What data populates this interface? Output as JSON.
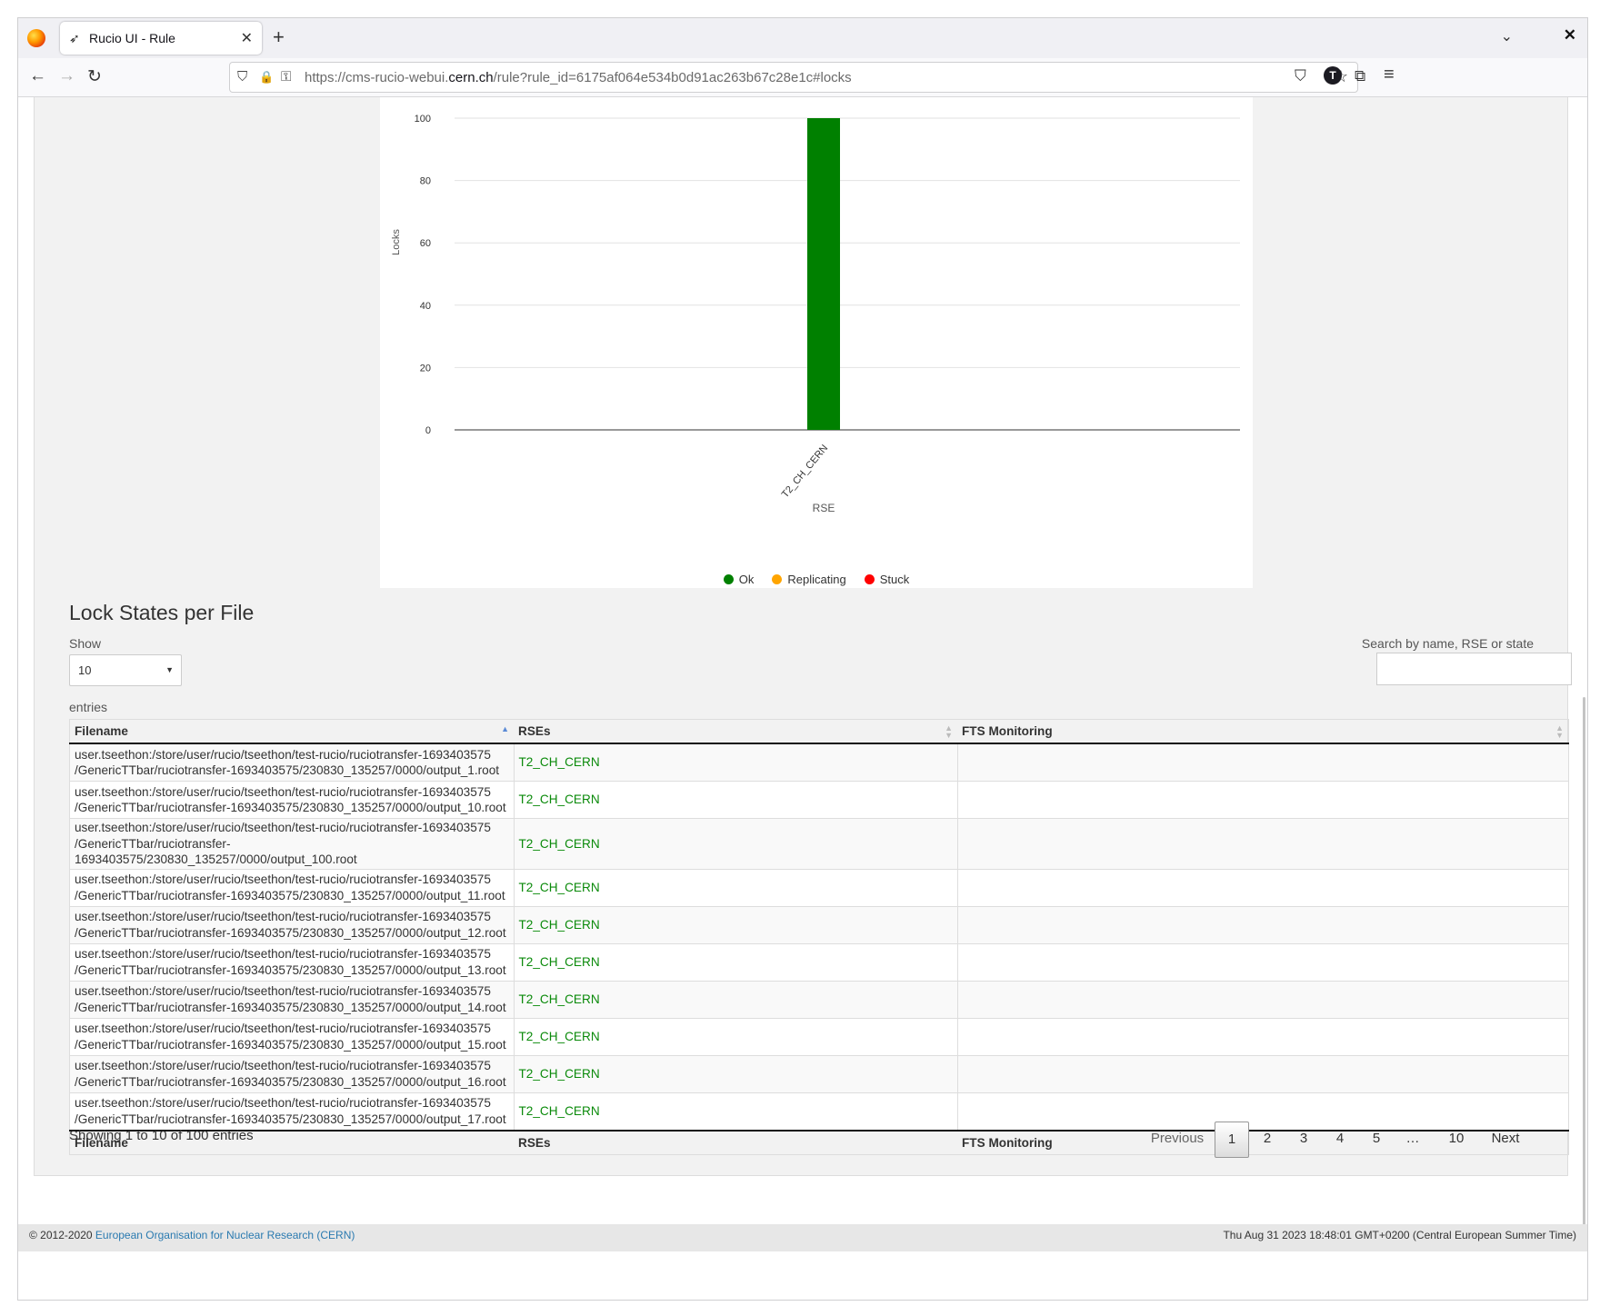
{
  "browser": {
    "tab_title": "Rucio UI - Rule",
    "tab_icon": "rucio-favicon",
    "url_prefix": "https://cms-rucio-webui.",
    "url_host": "cern.ch",
    "url_suffix": "/rule?rule_id=6175af064e534b0d91ac263b67c28e1c#locks",
    "account_initial": "T",
    "icons": {
      "close": "✕",
      "newtab": "+",
      "tab_list": "⌄",
      "window_close": "✕",
      "back": "←",
      "forward": "→",
      "reload": "↻",
      "shield": "⛉",
      "lock": "🔒",
      "permissions": "⚿",
      "star": "☆",
      "pocket": "⛉",
      "extensions": "⧉",
      "menu": "≡"
    }
  },
  "chart_data": {
    "type": "bar",
    "categories": [
      "T2_CH_CERN"
    ],
    "series": [
      {
        "name": "Ok",
        "color": "#008000",
        "values": [
          100
        ]
      },
      {
        "name": "Replicating",
        "color": "#ffa500",
        "values": [
          0
        ]
      },
      {
        "name": "Stuck",
        "color": "#ff0000",
        "values": [
          0
        ]
      }
    ],
    "xlabel": "RSE",
    "ylabel": "Locks",
    "ylim": [
      0,
      100
    ],
    "yticks": [
      0,
      20,
      40,
      60,
      80,
      100
    ],
    "grid": true,
    "legend": "bottom"
  },
  "locks": {
    "title": "Lock States per File",
    "show_label": "Show",
    "page_size": "10",
    "entries_label": "entries",
    "search_label": "Search by name, RSE or state",
    "search_value": "",
    "columns": [
      "Filename",
      "RSEs",
      "FTS Monitoring"
    ],
    "rows": [
      {
        "file_line1": "user.tseethon:/store/user/rucio/tseethon/test-rucio/ruciotransfer-1693403575",
        "file_line2": "/GenericTTbar/ruciotransfer-1693403575/230830_135257/0000/output_1.root",
        "rse": "T2_CH_CERN",
        "fts": ""
      },
      {
        "file_line1": "user.tseethon:/store/user/rucio/tseethon/test-rucio/ruciotransfer-1693403575",
        "file_line2": "/GenericTTbar/ruciotransfer-1693403575/230830_135257/0000/output_10.root",
        "rse": "T2_CH_CERN",
        "fts": ""
      },
      {
        "file_line1": "user.tseethon:/store/user/rucio/tseethon/test-rucio/ruciotransfer-1693403575",
        "file_line2": "/GenericTTbar/ruciotransfer-1693403575/230830_135257/0000/output_100.root",
        "rse": "T2_CH_CERN",
        "fts": ""
      },
      {
        "file_line1": "user.tseethon:/store/user/rucio/tseethon/test-rucio/ruciotransfer-1693403575",
        "file_line2": "/GenericTTbar/ruciotransfer-1693403575/230830_135257/0000/output_11.root",
        "rse": "T2_CH_CERN",
        "fts": ""
      },
      {
        "file_line1": "user.tseethon:/store/user/rucio/tseethon/test-rucio/ruciotransfer-1693403575",
        "file_line2": "/GenericTTbar/ruciotransfer-1693403575/230830_135257/0000/output_12.root",
        "rse": "T2_CH_CERN",
        "fts": ""
      },
      {
        "file_line1": "user.tseethon:/store/user/rucio/tseethon/test-rucio/ruciotransfer-1693403575",
        "file_line2": "/GenericTTbar/ruciotransfer-1693403575/230830_135257/0000/output_13.root",
        "rse": "T2_CH_CERN",
        "fts": ""
      },
      {
        "file_line1": "user.tseethon:/store/user/rucio/tseethon/test-rucio/ruciotransfer-1693403575",
        "file_line2": "/GenericTTbar/ruciotransfer-1693403575/230830_135257/0000/output_14.root",
        "rse": "T2_CH_CERN",
        "fts": ""
      },
      {
        "file_line1": "user.tseethon:/store/user/rucio/tseethon/test-rucio/ruciotransfer-1693403575",
        "file_line2": "/GenericTTbar/ruciotransfer-1693403575/230830_135257/0000/output_15.root",
        "rse": "T2_CH_CERN",
        "fts": ""
      },
      {
        "file_line1": "user.tseethon:/store/user/rucio/tseethon/test-rucio/ruciotransfer-1693403575",
        "file_line2": "/GenericTTbar/ruciotransfer-1693403575/230830_135257/0000/output_16.root",
        "rse": "T2_CH_CERN",
        "fts": ""
      },
      {
        "file_line1": "user.tseethon:/store/user/rucio/tseethon/test-rucio/ruciotransfer-1693403575",
        "file_line2": "/GenericTTbar/ruciotransfer-1693403575/230830_135257/0000/output_17.root",
        "rse": "T2_CH_CERN",
        "fts": ""
      }
    ],
    "info": "Showing 1 to 10 of 100 entries",
    "pagination": {
      "previous": "Previous",
      "pages": [
        "1",
        "2",
        "3",
        "4",
        "5"
      ],
      "ellipsis": "…",
      "last": "10",
      "next": "Next",
      "current": "1"
    }
  },
  "footer": {
    "copyright": "© 2012-2020",
    "org_link": "European Organisation for Nuclear Research (CERN)",
    "timestamp": "Thu Aug 31 2023 18:48:01 GMT+0200 (Central European Summer Time)"
  }
}
